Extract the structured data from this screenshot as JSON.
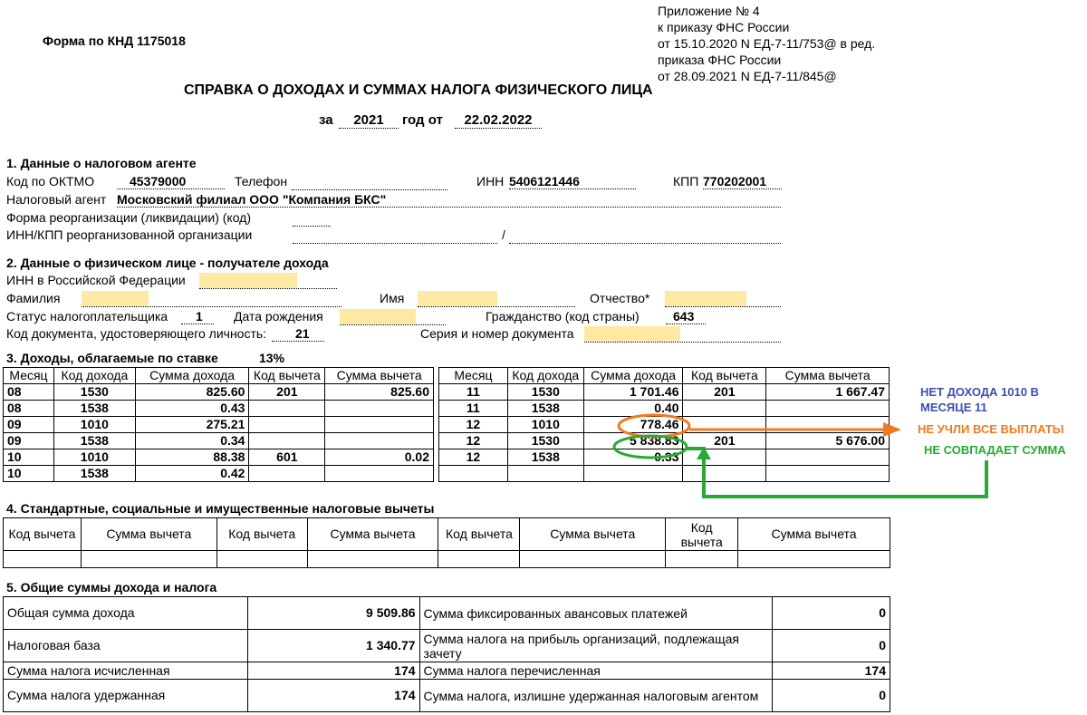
{
  "header": {
    "form_code": "Форма по КНД 1175018",
    "appendix": [
      "Приложение № 4",
      "к приказу ФНС России",
      "от 15.10.2020 N ЕД-7-11/753@ в ред.",
      "приказа ФНС России",
      "от 28.09.2021 N ЕД-7-11/845@"
    ],
    "title": "СПРАВКА О ДОХОДАХ И СУММАХ НАЛОГА ФИЗИЧЕСКОГО ЛИЦА",
    "za_label": "за",
    "year": "2021",
    "god_ot_label": "год от",
    "date": "22.02.2022"
  },
  "section1": {
    "title": "1. Данные о налоговом агенте",
    "oktmo_label": "Код по ОКТМО",
    "oktmo": "45379000",
    "phone_label": "Телефон",
    "inn_label": "ИНН",
    "inn": "5406121446",
    "kpp_label": "КПП",
    "kpp": "770202001",
    "agent_label": "Налоговый агент",
    "agent": "Московский филиал ООО \"Компания БКС\"",
    "reorg_label": "Форма реорганизации (ликвидации)  (код)",
    "reorg_inn_label": "ИНН/КПП  реорганизованной организации",
    "slash": "/"
  },
  "section2": {
    "title": "2. Данные о физическом лице - получателе дохода",
    "inn_label": "ИНН в Российской Федерации",
    "surname_label": "Фамилия",
    "name_label": "Имя",
    "patronymic_label": "Отчество*",
    "status_label": "Статус налогоплательщика",
    "status": "1",
    "birth_label": "Дата рождения",
    "citizenship_label": "Гражданство (код страны)",
    "citizenship": "643",
    "doc_code_label": "Код документа, удостоверяющего личность:",
    "doc_code": "21",
    "doc_num_label": "Серия и номер документа"
  },
  "section3": {
    "title": "3. Доходы, облагаемые по ставке",
    "rate": "13%",
    "headers": [
      "Месяц",
      "Код дохода",
      "Сумма дохода",
      "Код вычета",
      "Сумма вычета"
    ],
    "left_rows": [
      [
        "08",
        "1530",
        "825.60",
        "201",
        "825.60"
      ],
      [
        "08",
        "1538",
        "0.43",
        "",
        ""
      ],
      [
        "09",
        "1010",
        "275.21",
        "",
        ""
      ],
      [
        "09",
        "1538",
        "0.34",
        "",
        ""
      ],
      [
        "10",
        "1010",
        "88.38",
        "601",
        "0.02"
      ],
      [
        "10",
        "1538",
        "0.42",
        "",
        ""
      ]
    ],
    "right_rows": [
      [
        "11",
        "1530",
        "1 701.46",
        "201",
        "1 667.47"
      ],
      [
        "11",
        "1538",
        "0.40",
        "",
        ""
      ],
      [
        "12",
        "1010",
        "778.46",
        "",
        ""
      ],
      [
        "12",
        "1530",
        "5 838.83",
        "201",
        "5 676.00"
      ],
      [
        "12",
        "1538",
        "0.33",
        "",
        ""
      ],
      [
        "",
        "",
        "",
        "",
        ""
      ]
    ]
  },
  "section4": {
    "title": "4. Стандартные, социальные и имущественные налоговые вычеты",
    "headers": [
      "Код вычета",
      "Сумма вычета",
      "Код вычета",
      "Сумма вычета",
      "Код вычета",
      "Сумма вычета",
      "Код вычета",
      "Сумма вычета"
    ]
  },
  "section5": {
    "title": "5. Общие суммы дохода и налога",
    "rows": [
      {
        "l": "Общая сумма дохода",
        "lv": "9 509.86",
        "r": "Сумма фиксированных авансовых платежей",
        "rv": "0"
      },
      {
        "l": "Налоговая база",
        "lv": "1 340.77",
        "r": "Сумма налога на прибыль организаций, подлежащая зачету",
        "rv": "0"
      },
      {
        "l": "Сумма налога исчисленная",
        "lv": "174",
        "r": "Сумма налога перечисленная",
        "rv": "174"
      },
      {
        "l": "Сумма налога удержанная",
        "lv": "174",
        "r": "Сумма налога, излишне удержанная налоговым агентом",
        "rv": "0"
      }
    ]
  },
  "annotations": {
    "no_income": "НЕТ ДОХОДА 1010 В МЕСЯЦЕ 11",
    "not_all_payments": "НЕ УЧЛИ ВСЕ ВЫПЛАТЫ",
    "sum_mismatch": "НЕ СОВПАДАЕТ СУММА",
    "colors": {
      "blue": "#3d4fb0",
      "orange": "#f07a22",
      "green": "#2aa835"
    }
  }
}
